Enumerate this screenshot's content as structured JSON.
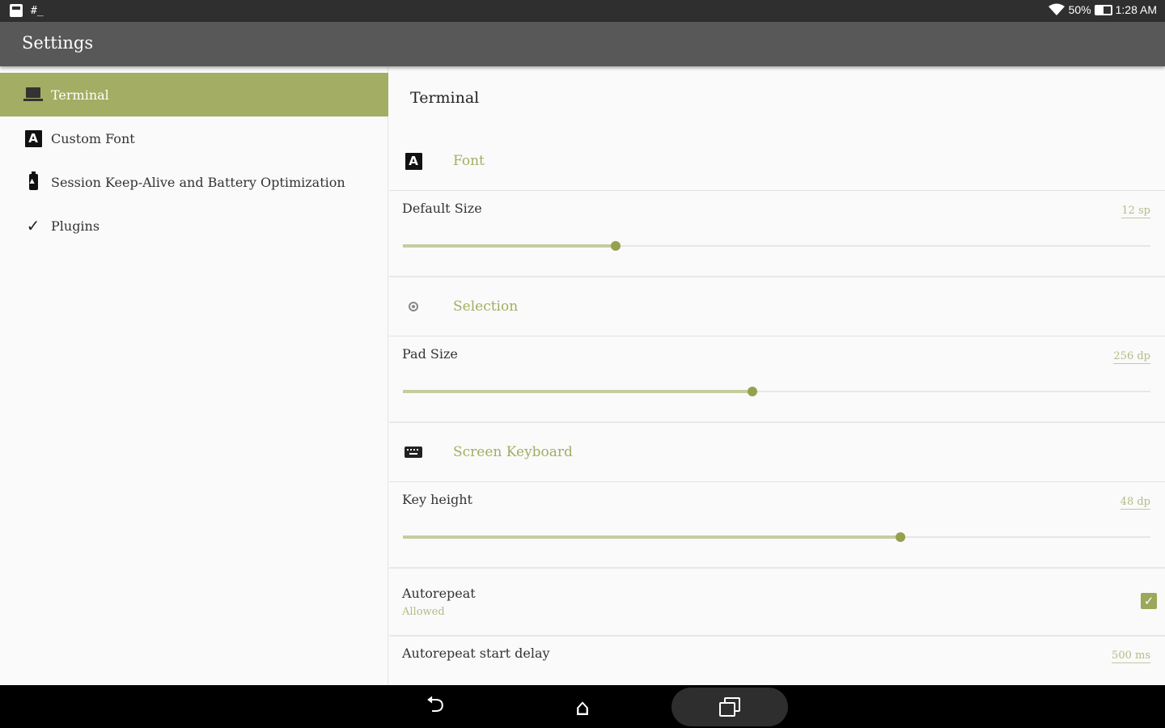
{
  "status_bar": {
    "terminal_glyph": "#_",
    "battery_percent": "50%",
    "battery_level": 0.5,
    "time": "1:28 AM"
  },
  "app_bar": {
    "title": "Settings"
  },
  "nav": {
    "items": [
      {
        "label": "Terminal",
        "icon": "laptop-icon",
        "active": true
      },
      {
        "label": "Custom Font",
        "icon": "font-a-icon",
        "active": false
      },
      {
        "label": "Session Keep-Alive and Battery Optimization",
        "icon": "battery-icon",
        "active": false
      },
      {
        "label": "Plugins",
        "icon": "check-icon",
        "active": false
      }
    ]
  },
  "content": {
    "heading": "Terminal",
    "categories": {
      "font": {
        "title": "Font",
        "icon": "font-a-icon"
      },
      "selection": {
        "title": "Selection",
        "icon": "gear-icon"
      },
      "keyboard": {
        "title": "Screen Keyboard",
        "icon": "keyboard-icon"
      }
    },
    "prefs": {
      "default_size": {
        "title": "Default Size",
        "value": "12 sp",
        "level": 0.285
      },
      "pad_size": {
        "title": "Pad Size",
        "value": "256 dp",
        "level": 0.467
      },
      "key_height": {
        "title": "Key height",
        "value": "48 dp",
        "level": 0.666
      },
      "autorepeat": {
        "title": "Autorepeat",
        "summary": "Allowed",
        "checked": true
      },
      "autorepeat_delay": {
        "title": "Autorepeat start delay",
        "value": "500 ms"
      }
    }
  },
  "colors": {
    "accent": "#a3ad63",
    "appbar": "#585858",
    "statusbar": "#2f2f2f"
  },
  "navbar": {
    "back_glyph": "⮌",
    "home_glyph": "⌂"
  }
}
